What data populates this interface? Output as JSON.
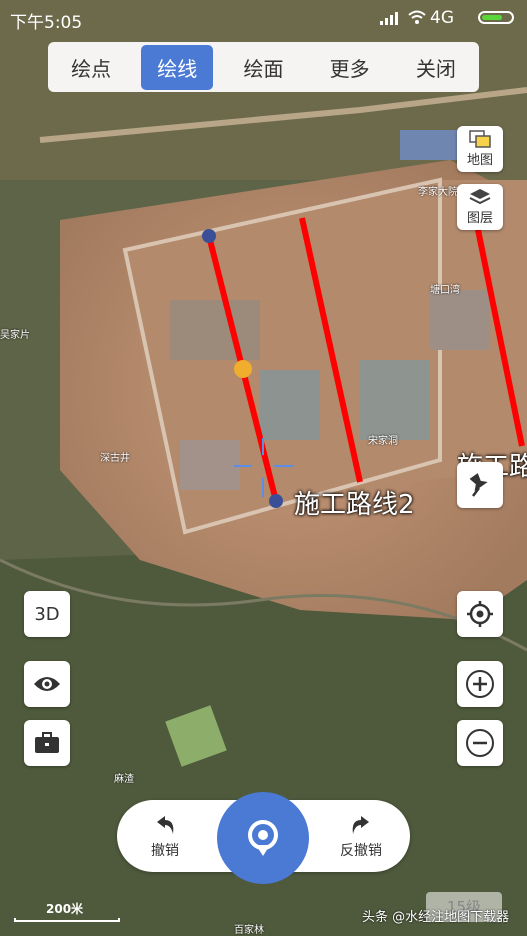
{
  "status_bar": {
    "time": "下午5:05",
    "network": "4G"
  },
  "toolbar": {
    "tabs": [
      {
        "label": "绘点"
      },
      {
        "label": "绘线",
        "active": true
      },
      {
        "label": "绘面"
      },
      {
        "label": "更多"
      },
      {
        "label": "关闭"
      }
    ]
  },
  "side_buttons": {
    "map_label": "地图",
    "layers_label": "图层",
    "btn_3d": "3D"
  },
  "routes": {
    "route2_label": "施工路线2",
    "route3_label": "施工路"
  },
  "map_labels": [
    "吴家片",
    "深古井",
    "麻渣",
    "宋家洞",
    "塘口湾",
    "李家大院",
    "百家林"
  ],
  "bottom_bar": {
    "undo_label": "撤销",
    "redo_label": "反撤销"
  },
  "scale": {
    "text": "200米"
  },
  "zoom_level": "15级",
  "watermark": "头条 @水经注地图下载器",
  "colors": {
    "accent": "#4a7ad4",
    "route": "#ff0000"
  }
}
